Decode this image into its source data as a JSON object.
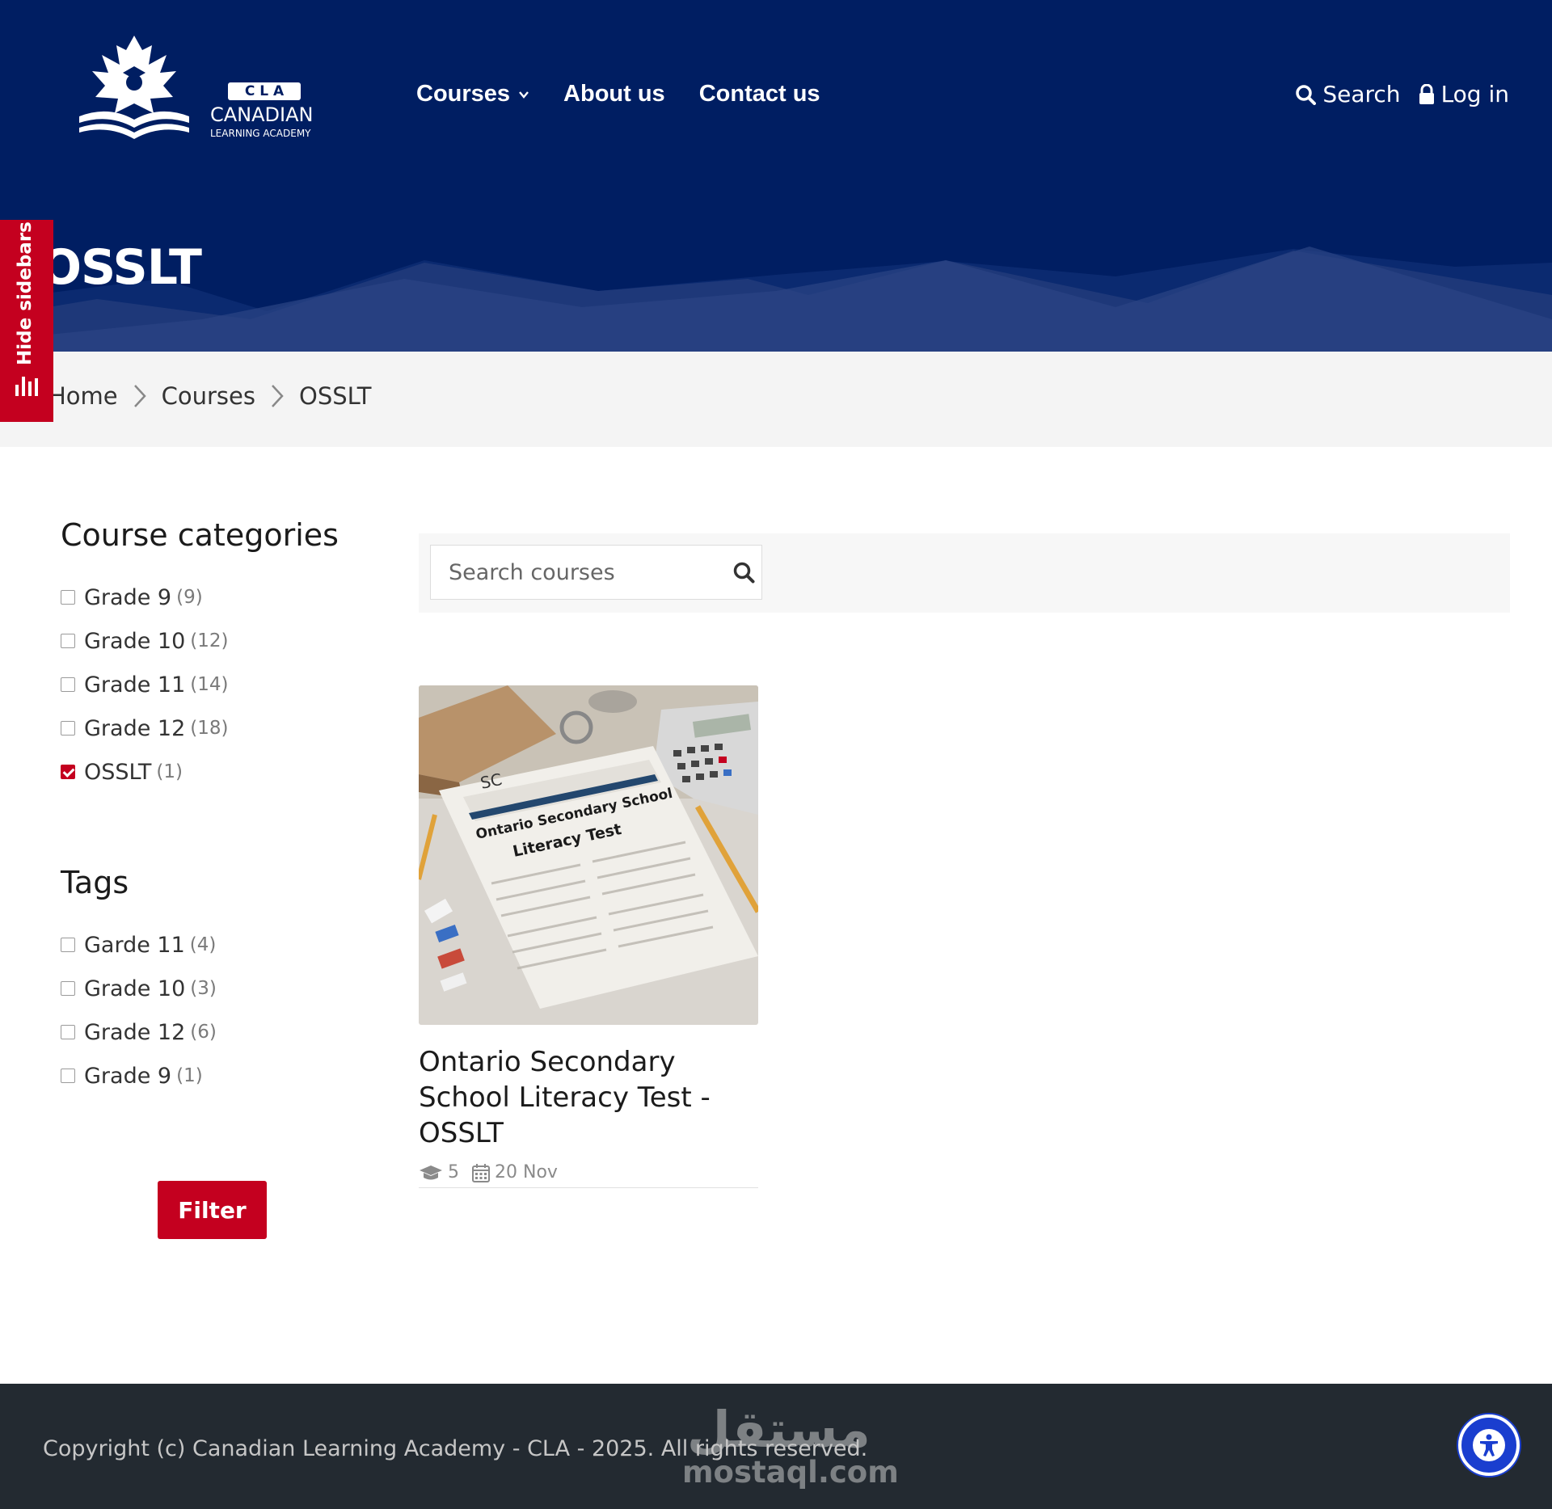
{
  "brand": {
    "badge": "C L A",
    "name": "CANADIAN",
    "tagline": "LEARNING ACADEMY"
  },
  "nav": {
    "items": [
      {
        "label": "Courses",
        "icon": "chevron-down-icon"
      },
      {
        "label": "About us"
      },
      {
        "label": "Contact us"
      }
    ],
    "search_label": "Search",
    "login_label": "Log in"
  },
  "page": {
    "title": "OSSLT"
  },
  "sidebar_toggle": {
    "label": "Hide sidebars",
    "icon": "bar-chart-icon"
  },
  "breadcrumb": {
    "items": [
      "Home",
      "Courses",
      "OSSLT"
    ]
  },
  "filters": {
    "categories_title": "Course categories",
    "categories": [
      {
        "label": "Grade 9",
        "count": "(9)",
        "checked": false
      },
      {
        "label": "Grade 10",
        "count": "(12)",
        "checked": false
      },
      {
        "label": "Grade 11",
        "count": "(14)",
        "checked": false
      },
      {
        "label": "Grade 12",
        "count": "(18)",
        "checked": false
      },
      {
        "label": "OSSLT",
        "count": "(1)",
        "checked": true
      }
    ],
    "tags_title": "Tags",
    "tags": [
      {
        "label": "Garde 11",
        "count": "(4)",
        "checked": false
      },
      {
        "label": "Grade 10",
        "count": "(3)",
        "checked": false
      },
      {
        "label": "Grade 12",
        "count": "(6)",
        "checked": false
      },
      {
        "label": "Grade 9",
        "count": "(1)",
        "checked": false
      }
    ],
    "button_label": "Filter"
  },
  "search": {
    "placeholder": "Search courses",
    "icon": "search-icon"
  },
  "courses": [
    {
      "title": "Ontario Secondary School Literacy Test - OSSLT",
      "students": "5",
      "date": "20 Nov",
      "thumbnail": {
        "header": "SC",
        "line1": "Ontario Secondary School",
        "line2": "Literacy Test"
      }
    }
  ],
  "footer": {
    "copyright": "Copyright (c) Canadian Learning Academy - CLA - 2025. All rights reserved.",
    "watermark_arabic": "مستقل",
    "watermark_latin": "mostaql.com"
  },
  "colors": {
    "header_bg": "#001e62",
    "accent_red": "#c4001f",
    "footer_bg": "#232a31",
    "accessibility_blue": "#1a3ecf"
  }
}
